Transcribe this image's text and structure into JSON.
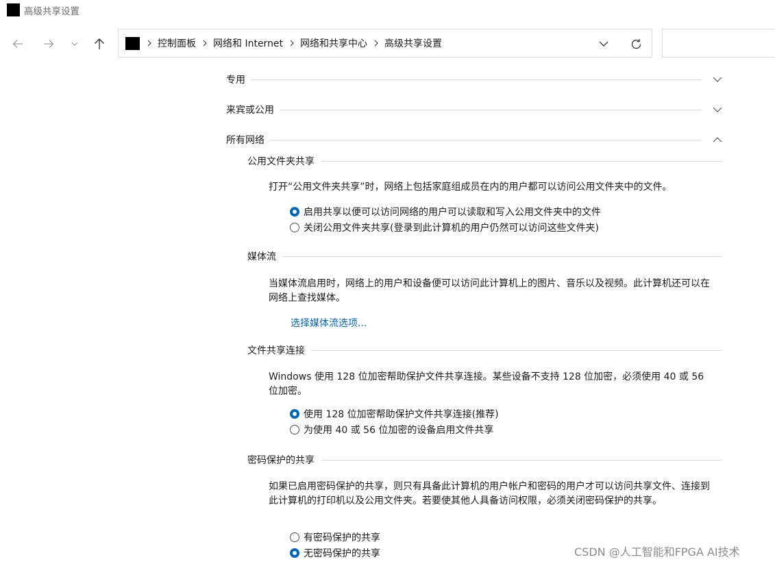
{
  "window": {
    "title": "高级共享设置"
  },
  "breadcrumb": {
    "items": [
      "控制面板",
      "网络和 Internet",
      "网络和共享中心",
      "高级共享设置"
    ]
  },
  "sections": {
    "private": "专用",
    "guest_public": "来宾或公用",
    "all_networks": "所有网络"
  },
  "public_folder": {
    "heading": "公用文件夹共享",
    "description": "打开“公用文件夹共享”时，网络上包括家庭组成员在内的用户都可以访问公用文件夹中的文件。",
    "option_on": "启用共享以便可以访问网络的用户可以读取和写入公用文件夹中的文件",
    "option_off": "关闭公用文件夹共享(登录到此计算机的用户仍然可以访问这些文件夹)"
  },
  "media": {
    "heading": "媒体流",
    "description": "当媒体流启用时，网络上的用户和设备便可以访问此计算机上的图片、音乐以及视频。此计算机还可以在网络上查找媒体。",
    "link": "选择媒体流选项..."
  },
  "file_sharing": {
    "heading": "文件共享连接",
    "description": "Windows 使用 128 位加密帮助保护文件共享连接。某些设备不支持 128 位加密，必须使用 40 或 56 位加密。",
    "option_128": "使用 128 位加密帮助保护文件共享连接(推荐)",
    "option_40_56": "为使用 40 或 56 位加密的设备启用文件共享"
  },
  "password": {
    "heading": "密码保护的共享",
    "description": "如果已启用密码保护的共享，则只有具备此计算机的用户帐户和密码的用户才可以访问共享文件、连接到此计算机的打印机以及公用文件夹。若要使其他人具备访问权限，必须关闭密码保护的共享。",
    "option_on": "有密码保护的共享",
    "option_off": "无密码保护的共享"
  },
  "selected": {
    "public_folder": "on",
    "file_sharing": "128",
    "password": "off"
  },
  "watermark": "CSDN @人工智能和FPGA AI技术",
  "colors": {
    "accent": "#0067c0"
  }
}
